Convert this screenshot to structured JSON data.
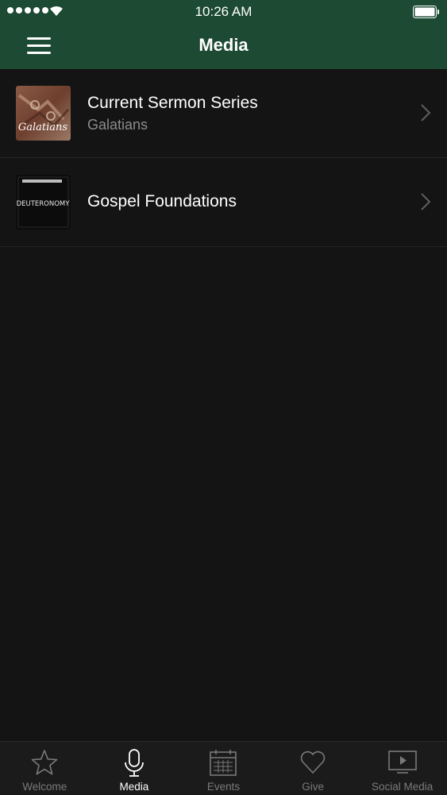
{
  "status_bar": {
    "time": "10:26 AM"
  },
  "header": {
    "title": "Media"
  },
  "media_items": [
    {
      "title": "Current Sermon Series",
      "subtitle": "Galatians",
      "thumbnail_text": "Galatians"
    },
    {
      "title": "Gospel Foundations",
      "thumbnail_text": "DEUTERONOMY"
    }
  ],
  "tabs": [
    {
      "label": "Welcome",
      "icon": "star-icon"
    },
    {
      "label": "Media",
      "icon": "microphone-icon",
      "active": true
    },
    {
      "label": "Events",
      "icon": "calendar-icon"
    },
    {
      "label": "Give",
      "icon": "heart-icon"
    },
    {
      "label": "Social Media",
      "icon": "tv-play-icon"
    }
  ],
  "colors": {
    "header": "#1d4a33",
    "background": "#141414",
    "tab_bar": "#1b1b1b"
  }
}
